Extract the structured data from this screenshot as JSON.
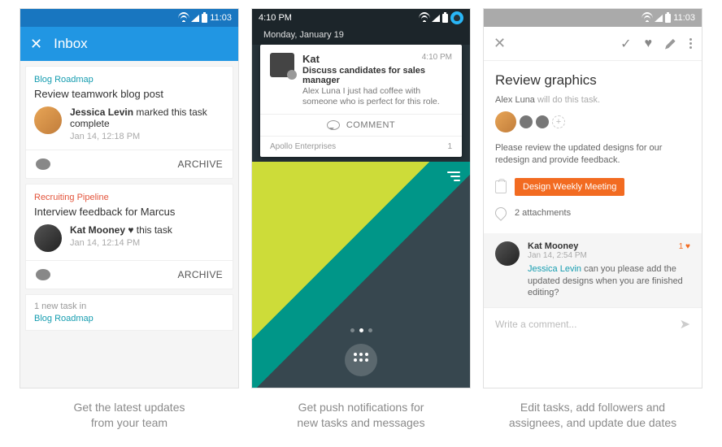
{
  "status_time": "11:03",
  "phone1": {
    "title": "Inbox",
    "card1": {
      "project": "Blog Roadmap",
      "title": "Review teamwork blog post",
      "actor": "Jessica Levin",
      "action": " marked this task complete",
      "ts": "Jan 14, 12:18 PM",
      "archive": "ARCHIVE"
    },
    "card2": {
      "project": "Recruiting Pipeline",
      "title": "Interview feedback for Marcus",
      "actor": "Kat Mooney",
      "action": " ♥ this task",
      "ts": "Jan 14, 12:14 PM",
      "archive": "ARCHIVE"
    },
    "snippet": {
      "lead": "1 new task in",
      "project": "Blog Roadmap"
    }
  },
  "phone2": {
    "clock": "4:10 PM",
    "date": "Monday, January 19",
    "notif": {
      "app_initial": "Kat",
      "title": "Kat",
      "right_time": "4:10 PM",
      "subject": "Discuss candidates for sales manager",
      "body": "Alex Luna I just had coffee with someone who is perfect for this role.",
      "comment": "COMMENT",
      "source": "Apollo Enterprises",
      "count": "1"
    }
  },
  "phone3": {
    "title": "Review graphics",
    "assignee": "Alex Luna",
    "assignee_suffix": " will do this task.",
    "desc": "Please review the updated designs for our redesign and provide feedback.",
    "tag": "Design Weekly Meeting",
    "attachments": "2 attachments",
    "comment": {
      "author": "Kat Mooney",
      "ts": "Jan 14, 2:54 PM",
      "likes": "1 ♥",
      "mention": "Jessica Levin",
      "text": " can you please add the updated designs when you are finished editing?"
    },
    "input_placeholder": "Write a comment..."
  },
  "captions": {
    "c1": "Get the latest updates\nfrom your team",
    "c2": "Get push notifications for\nnew tasks and messages",
    "c3": "Edit tasks, add followers and\nassignees, and update due dates"
  }
}
